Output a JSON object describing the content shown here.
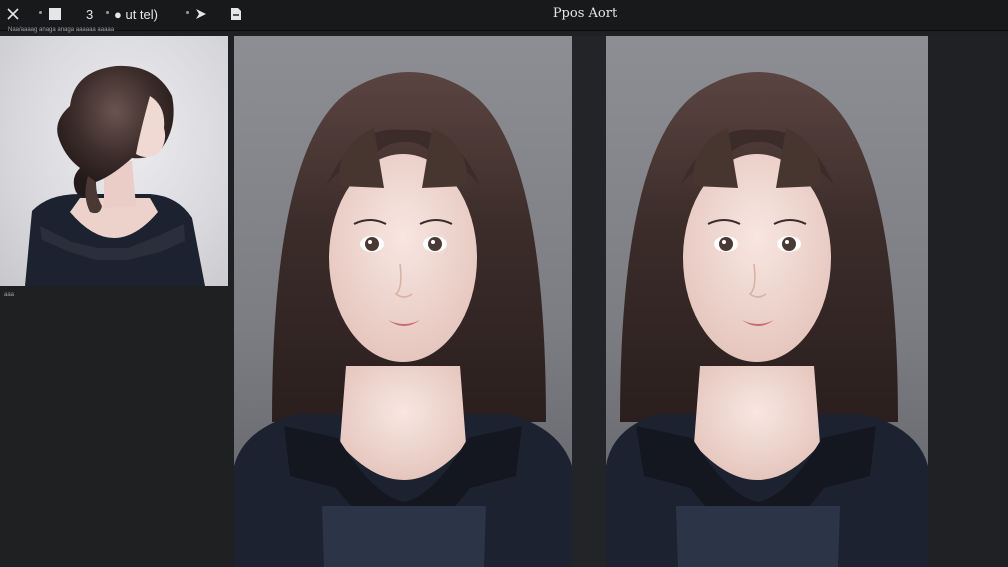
{
  "toolbar": {
    "close_icon": "close-icon",
    "crop_icon": "crop-square-icon",
    "rotate_label": "3",
    "edit_label": "● ut tel)",
    "share_icon": "share-arrow-icon",
    "export_icon": "export-icon"
  },
  "window": {
    "title": "Ppos Aort"
  },
  "sidebar": {
    "meta_text": "Naa/aaaag anaga  anaga aaaaaa  aaaaa",
    "item_label": "aaa"
  },
  "colors": {
    "background": "#1f2022",
    "toolbar": "#18191b",
    "hair": "#3b2c29",
    "dress": "#1d2230",
    "skin": "#f1d9d3"
  }
}
